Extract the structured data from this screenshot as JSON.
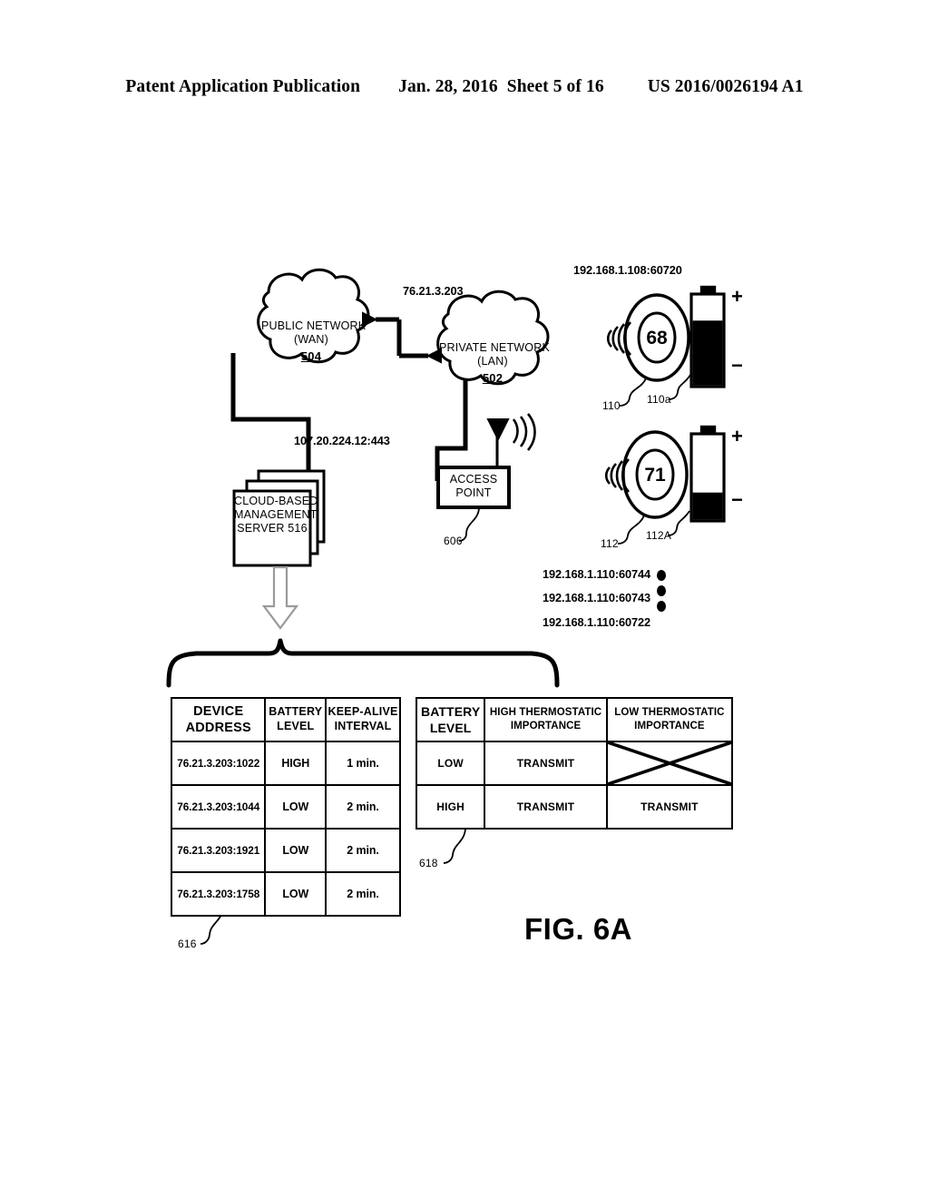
{
  "header": {
    "publication": "Patent Application Publication",
    "date": "Jan. 28, 2016",
    "sheet": "Sheet 5 of 16",
    "patent_number": "US 2016/0026194 A1"
  },
  "figure": {
    "title": "FIG. 6A"
  },
  "diagram": {
    "public_network": {
      "line1": "PUBLIC NETWORK",
      "line2": "(WAN)",
      "ref": "504"
    },
    "private_network": {
      "line1": "PRIVATE NETWORK",
      "line2": "(LAN)",
      "ref": "502"
    },
    "wan_lan_address": "76.21.3.203",
    "server_address": "107.20.224.12:443",
    "server": {
      "line1": "CLOUD-BASED",
      "line2": "MANAGEMENT",
      "line3": "SERVER 516"
    },
    "access_point": {
      "line1": "ACCESS",
      "line2": "POINT",
      "ref": "606"
    },
    "devices": [
      {
        "address": "192.168.1.108:60720",
        "temperature": "68",
        "device_ref": "110",
        "battery_ref": "110a",
        "battery_level_percent": 72,
        "plus": "+",
        "minus": "−"
      },
      {
        "temperature": "71",
        "device_ref": "112",
        "battery_ref": "112A",
        "battery_level_percent": 32,
        "plus": "+",
        "minus": "−"
      }
    ],
    "extra_addresses": [
      "192.168.1.110:60744",
      "192.168.1.110:60743",
      "192.168.1.110:60722"
    ]
  },
  "table_616": {
    "ref": "616",
    "headers": [
      "DEVICE ADDRESS",
      "BATTERY LEVEL",
      "KEEP-ALIVE INTERVAL"
    ],
    "header_lines": [
      [
        "DEVICE",
        "ADDRESS"
      ],
      [
        "BATTERY",
        "LEVEL"
      ],
      [
        "KEEP-ALIVE",
        "INTERVAL"
      ]
    ],
    "rows": [
      [
        "76.21.3.203:1022",
        "HIGH",
        "1 min."
      ],
      [
        "76.21.3.203:1044",
        "LOW",
        "2 min."
      ],
      [
        "76.21.3.203:1921",
        "LOW",
        "2 min."
      ],
      [
        "76.21.3.203:1758",
        "LOW",
        "2 min."
      ]
    ]
  },
  "table_618": {
    "ref": "618",
    "header_lines": [
      [
        "BATTERY",
        "LEVEL"
      ],
      [
        "HIGH THERMOSTATIC",
        "IMPORTANCE"
      ],
      [
        "LOW THERMOSTATIC",
        "IMPORTANCE"
      ]
    ],
    "rows": [
      {
        "battery_level": "LOW",
        "high_importance": "TRANSMIT",
        "low_importance": "",
        "low_importance_crossed": true
      },
      {
        "battery_level": "HIGH",
        "high_importance": "TRANSMIT",
        "low_importance": "TRANSMIT",
        "low_importance_crossed": false
      }
    ]
  },
  "colors": {
    "ink": "#000000",
    "paper": "#ffffff"
  }
}
